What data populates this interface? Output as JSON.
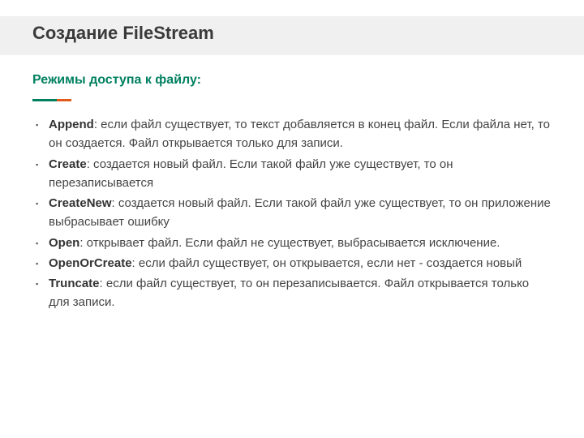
{
  "title": "Создание FileStream",
  "subtitle": "Режимы доступа к файлу:",
  "modes": [
    {
      "term": "Append",
      "desc": ": если файл существует, то текст добавляется в конец файл. Если файла нет, то он создается. Файл открывается только для записи."
    },
    {
      "term": "Create",
      "desc": ": создается новый файл. Если такой файл уже существует, то он перезаписывается"
    },
    {
      "term": "CreateNew",
      "desc": ": создается новый файл. Если такой файл уже существует, то он приложение выбрасывает ошибку"
    },
    {
      "term": "Open",
      "desc": ": открывает файл. Если файл не существует, выбрасывается исключение."
    },
    {
      "term": "OpenOrCreate",
      "desc": ": если файл существует, он открывается, если нет - создается новый"
    },
    {
      "term": "Truncate",
      "desc": ": если файл существует, то он перезаписывается. Файл открывается только для записи."
    }
  ]
}
